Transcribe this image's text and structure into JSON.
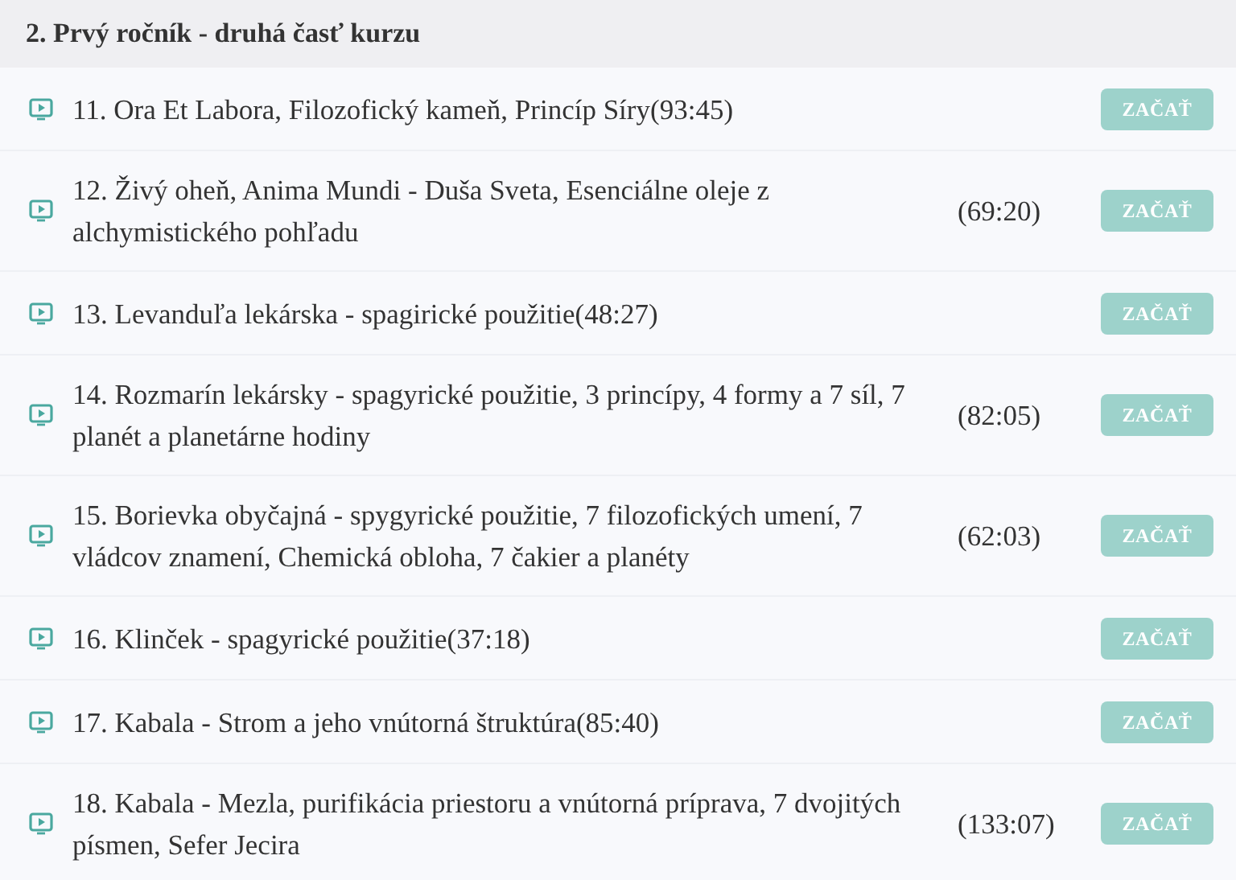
{
  "section": {
    "title": "2. Prvý ročník - druhá časť kurzu"
  },
  "lessons": [
    {
      "title": "11. Ora Et Labora, Filozofický kameň, Princíp Síry",
      "duration": "(93:45)",
      "button": "ZAČAŤ"
    },
    {
      "title": "12. Živý oheň, Anima Mundi - Duša Sveta, Esenciálne oleje z alchymistického pohľadu",
      "duration": "(69:20)",
      "button": "ZAČAŤ"
    },
    {
      "title": "13. Levanduľa lekárska - spagirické použitie",
      "duration": "(48:27)",
      "button": "ZAČAŤ"
    },
    {
      "title": "14. Rozmarín lekársky - spagyrické použitie, 3 princípy, 4 formy a 7 síl, 7 planét a planetárne hodiny",
      "duration": "(82:05)",
      "button": "ZAČAŤ"
    },
    {
      "title": "15. Borievka obyčajná - spygyrické použitie, 7 filozofických umení, 7 vládcov znamení, Chemická obloha, 7 čakier a planéty",
      "duration": "(62:03)",
      "button": "ZAČAŤ"
    },
    {
      "title": "16. Klinček - spagyrické použitie",
      "duration": "(37:18)",
      "button": "ZAČAŤ"
    },
    {
      "title": "17. Kabala - Strom a jeho vnútorná štruktúra",
      "duration": "(85:40)",
      "button": "ZAČAŤ"
    },
    {
      "title": "18. Kabala - Mezla, purifikácia priestoru a vnútorná príprava, 7 dvojitých písmen, Sefer Jecira",
      "duration": "(133:07)",
      "button": "ZAČAŤ"
    }
  ]
}
